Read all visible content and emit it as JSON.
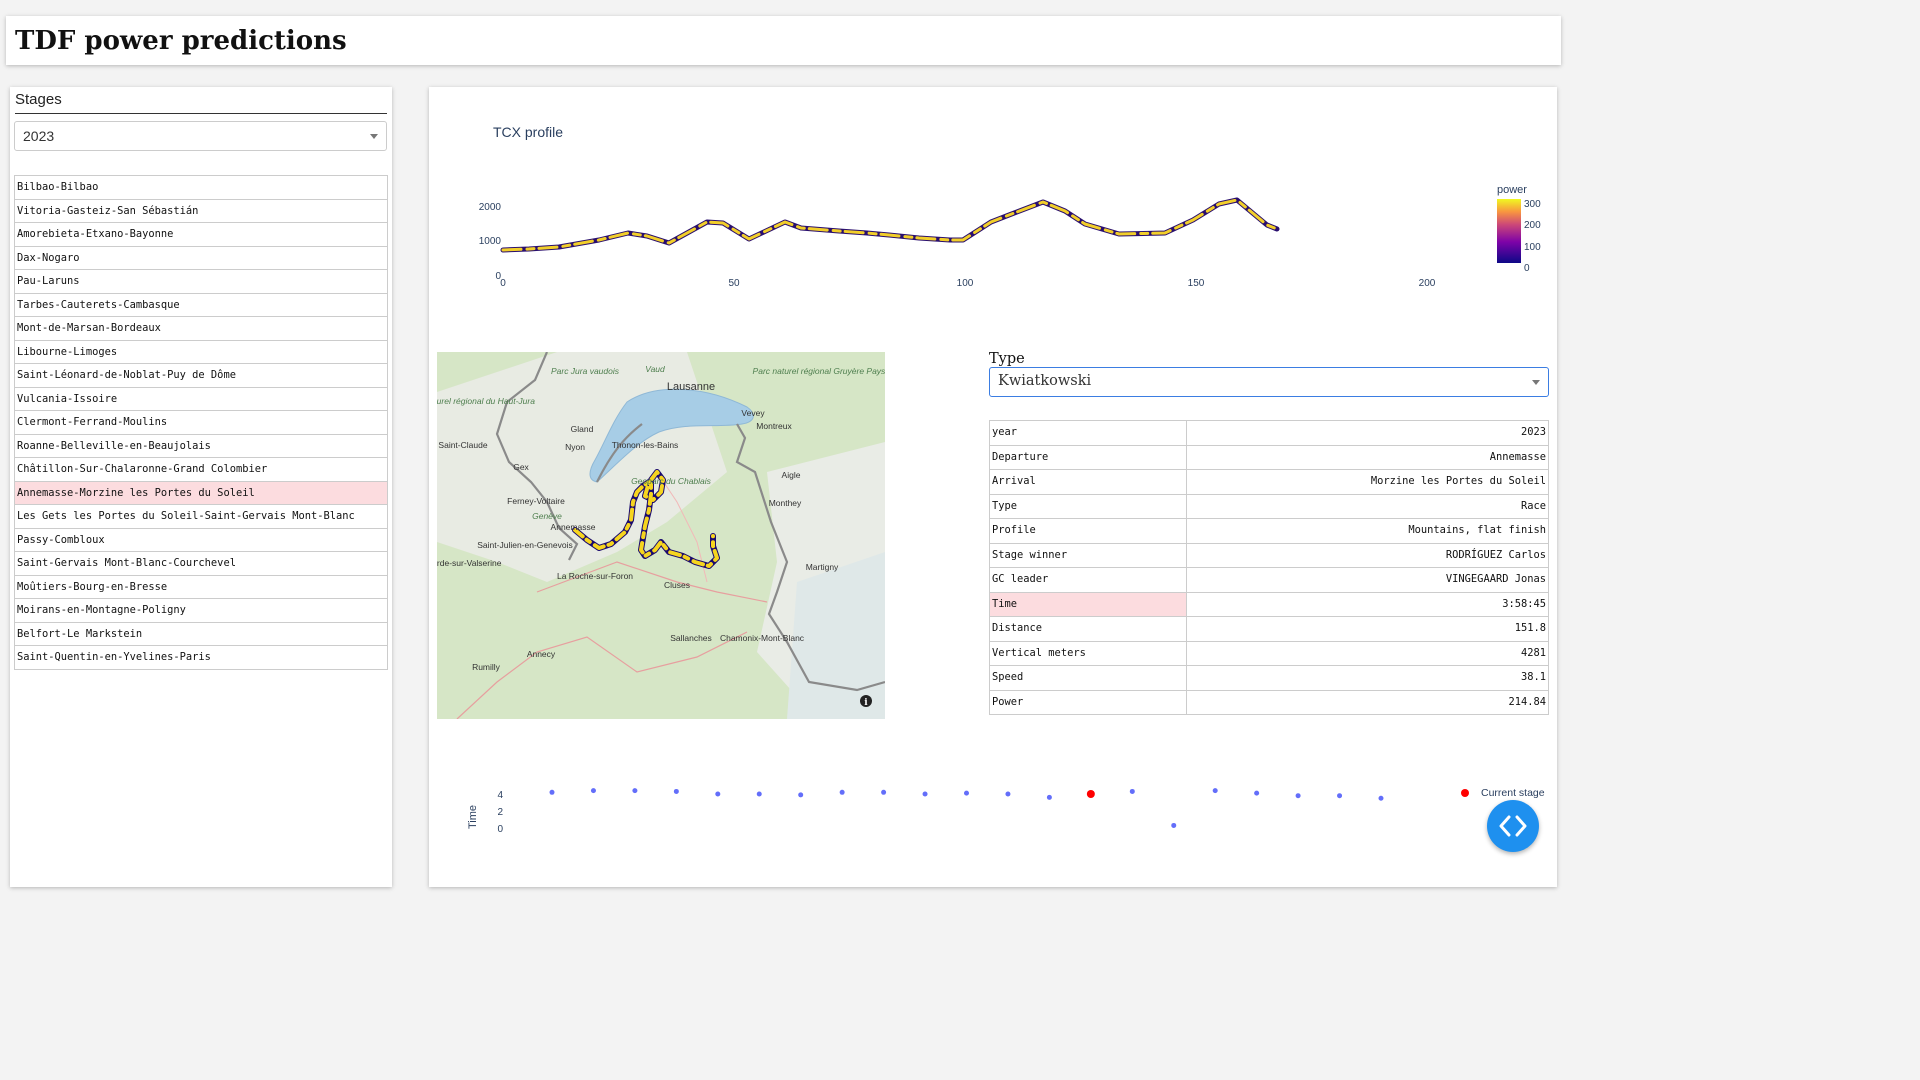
{
  "app": {
    "title": "TDF power predictions"
  },
  "sidebar": {
    "title": "Stages",
    "year_select": {
      "value": "2023"
    },
    "stages": [
      "Bilbao-Bilbao",
      "Vitoria-Gasteiz-San Sébastián",
      "Amorebieta-Etxano-Bayonne",
      "Dax-Nogaro",
      "Pau-Laruns",
      "Tarbes-Cauterets-Cambasque",
      "Mont-de-Marsan-Bordeaux",
      "Libourne-Limoges",
      "Saint-Léonard-de-Noblat-Puy de Dôme",
      "Vulcania-Issoire",
      "Clermont-Ferrand-Moulins",
      "Roanne-Belleville-en-Beaujolais",
      "Châtillon-Sur-Chalaronne-Grand Colombier",
      "Annemasse-Morzine les Portes du Soleil",
      "Les Gets les Portes du Soleil-Saint-Gervais Mont-Blanc",
      "Passy-Combloux",
      "Saint-Gervais Mont-Blanc-Courchevel",
      "Moûtiers-Bourg-en-Bresse",
      "Moirans-en-Montagne-Poligny",
      "Belfort-Le Markstein",
      "Saint-Quentin-en-Yvelines-Paris"
    ],
    "selected_stage": "Annemasse-Morzine les Portes du Soleil"
  },
  "profile_chart": {
    "title": "TCX profile",
    "colorbar": {
      "title": "power",
      "ticks": [
        "300",
        "200",
        "100",
        "0"
      ]
    },
    "x_ticks": [
      "0",
      "50",
      "100",
      "150",
      "200"
    ],
    "y_ticks": [
      "2000",
      "1000",
      "0"
    ]
  },
  "map": {
    "labels": [
      "Parc Jura vaudois",
      "Vaud",
      "Lausanne",
      "Parc naturel régional du Haut-Jura",
      "Saint-Claude",
      "Gland",
      "Nyon",
      "Thonon-les-Bains",
      "Vevey",
      "Montreux",
      "Parc naturel régional Gruyère Pays-d'Enhaut",
      "Gex",
      "Aigle",
      "Ferney-Voltaire",
      "Geoparc du Chablais",
      "Genève",
      "Annemasse",
      "Monthey",
      "Saint-Julien-en-Genevois",
      "Martigny",
      "La Roche-sur-Foron",
      "Cluses",
      "Sallanches",
      "Chamonix-Mont-Blanc",
      "Annecy",
      "Rumilly",
      "Bellegarde-sur-Valserine"
    ],
    "info_icon": "info-icon"
  },
  "details": {
    "type_label": "Type",
    "type_select": {
      "value": "Kwiatkowski"
    },
    "rows": [
      {
        "key": "year",
        "value": "2023"
      },
      {
        "key": "Departure",
        "value": "Annemasse"
      },
      {
        "key": "Arrival",
        "value": "Morzine les Portes du Soleil"
      },
      {
        "key": "Type",
        "value": "Race"
      },
      {
        "key": "Profile",
        "value": "Mountains, flat finish"
      },
      {
        "key": "Stage winner",
        "value": "RODRÍGUEZ Carlos"
      },
      {
        "key": "GC leader",
        "value": "VINGEGAARD Jonas"
      },
      {
        "key": "Time",
        "value": "3:58:45"
      },
      {
        "key": "Distance",
        "value": "151.8"
      },
      {
        "key": "Vertical meters",
        "value": "4281"
      },
      {
        "key": "Speed",
        "value": "38.1"
      },
      {
        "key": "Power",
        "value": "214.84"
      }
    ],
    "highlighted_row": "Time"
  },
  "chart_data": {
    "type": "scatter",
    "ylabel": "Time",
    "y_ticks": [
      "4",
      "2",
      "0"
    ],
    "legend": {
      "name": "Current stage",
      "color": "#ff0000",
      "placement": "top-right"
    },
    "series_color": "#636efa",
    "current_stage_index": 13,
    "x": [
      1,
      2,
      3,
      4,
      5,
      6,
      7,
      8,
      9,
      10,
      11,
      12,
      13,
      14,
      15,
      16,
      17,
      18,
      19,
      20,
      21
    ],
    "values": [
      4.2,
      4.4,
      4.4,
      4.3,
      4.0,
      4.0,
      3.9,
      4.2,
      4.2,
      4.0,
      4.1,
      4.0,
      3.6,
      4.0,
      4.3,
      0.3,
      4.4,
      4.1,
      3.8,
      3.8,
      3.5
    ]
  },
  "fab": {
    "icon": "code-icon"
  }
}
